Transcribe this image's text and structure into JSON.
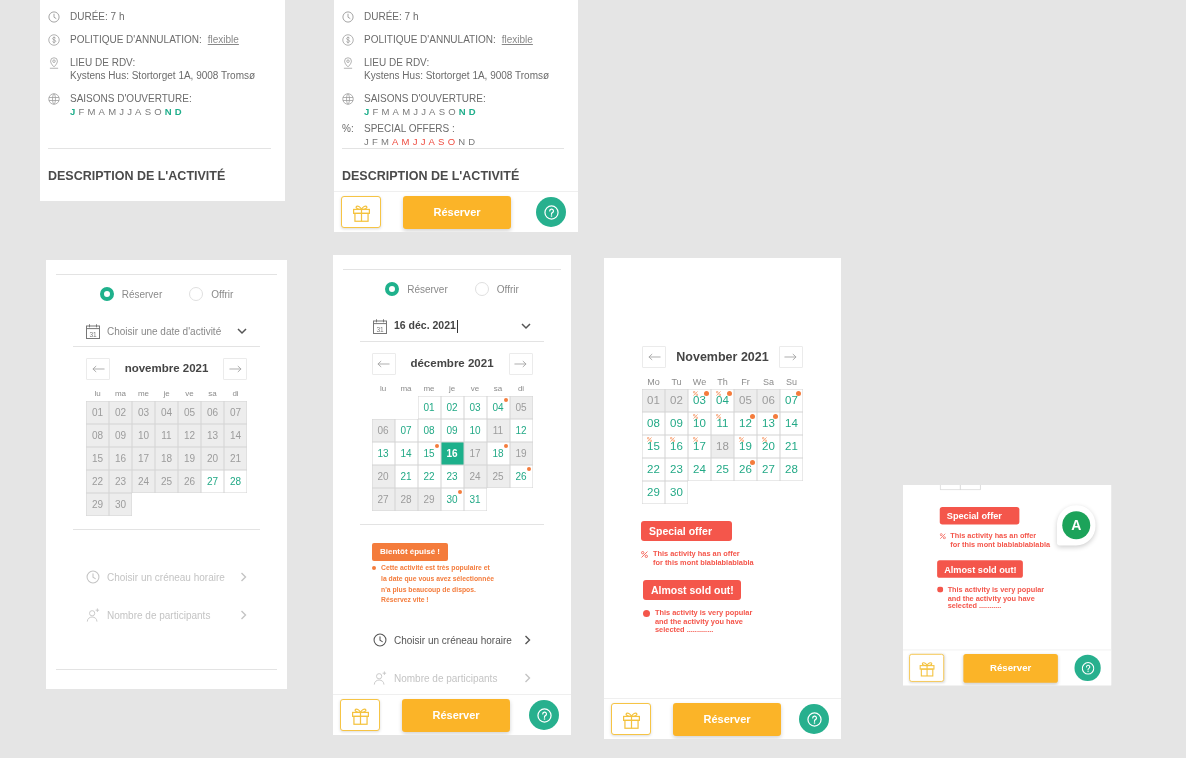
{
  "screens": [
    {
      "blocks": [
        {
          "kind": "info",
          "items": [
            {
              "kind": "duration",
              "label": "DURÉE: 7 h"
            },
            {
              "kind": "cancellation",
              "label": "POLITIQUE D'ANNULATION:",
              "link": "flexible"
            },
            {
              "kind": "meeting_point",
              "label": "LIEU DE RDV:",
              "value": "Kystens Hus: Stortorget 1A, 9008 Tromsø"
            },
            {
              "kind": "seasons",
              "label": "SAISONS D'OUVERTURE:",
              "months": [
                {
                  "letter": "J",
                  "on": true
                },
                {
                  "letter": "F",
                  "on": false
                },
                {
                  "letter": "M",
                  "on": false
                },
                {
                  "letter": "A",
                  "on": false
                },
                {
                  "letter": "M",
                  "on": false
                },
                {
                  "letter": "J",
                  "on": false
                },
                {
                  "letter": "J",
                  "on": false
                },
                {
                  "letter": "A",
                  "on": false
                },
                {
                  "letter": "S",
                  "on": false
                },
                {
                  "letter": "O",
                  "on": false
                },
                {
                  "letter": "N",
                  "on": true
                },
                {
                  "letter": "D",
                  "on": true
                }
              ]
            }
          ]
        },
        {
          "kind": "rule"
        },
        {
          "kind": "heading",
          "text": "DESCRIPTION DE L'ACTIVITÉ"
        }
      ]
    },
    {
      "blocks": [
        {
          "kind": "info",
          "items": [
            {
              "kind": "duration",
              "label": "DURÉE: 7 h"
            },
            {
              "kind": "cancellation",
              "label": "POLITIQUE D'ANNULATION:",
              "link": "flexible"
            },
            {
              "kind": "meeting_point",
              "label": "LIEU DE RDV:",
              "value": "Kystens Hus: Stortorget 1A, 9008 Tromsø"
            },
            {
              "kind": "seasons",
              "label": "SAISONS D'OUVERTURE:",
              "months": [
                {
                  "letter": "J",
                  "on": true
                },
                {
                  "letter": "F",
                  "on": false
                },
                {
                  "letter": "M",
                  "on": false
                },
                {
                  "letter": "A",
                  "on": false
                },
                {
                  "letter": "M",
                  "on": false
                },
                {
                  "letter": "J",
                  "on": false
                },
                {
                  "letter": "J",
                  "on": false
                },
                {
                  "letter": "A",
                  "on": false
                },
                {
                  "letter": "S",
                  "on": false
                },
                {
                  "letter": "O",
                  "on": false
                },
                {
                  "letter": "N",
                  "on": true
                },
                {
                  "letter": "D",
                  "on": true
                }
              ]
            },
            {
              "kind": "offers",
              "prefix": "%:",
              "label": "SPECIAL OFFERS :",
              "months": [
                {
                  "letter": "J",
                  "on": false
                },
                {
                  "letter": "F",
                  "on": false
                },
                {
                  "letter": "M",
                  "on": false
                },
                {
                  "letter": "A",
                  "on": true
                },
                {
                  "letter": "M",
                  "on": true
                },
                {
                  "letter": "J",
                  "on": true
                },
                {
                  "letter": "J",
                  "on": true
                },
                {
                  "letter": "A",
                  "on": true
                },
                {
                  "letter": "S",
                  "on": true
                },
                {
                  "letter": "O",
                  "on": true
                },
                {
                  "letter": "N",
                  "on": false
                },
                {
                  "letter": "D",
                  "on": false
                }
              ]
            }
          ]
        },
        {
          "kind": "rule"
        },
        {
          "kind": "heading",
          "text": "DESCRIPTION DE L'ACTIVITÉ"
        },
        {
          "kind": "footer",
          "book_label": "Réserver"
        }
      ]
    },
    {
      "blocks": [
        {
          "kind": "rule"
        },
        {
          "kind": "choice",
          "options": [
            {
              "label": "Réserver",
              "selected": true
            },
            {
              "label": "Offrir",
              "selected": false
            }
          ]
        },
        {
          "kind": "date_field",
          "icon_label": "31",
          "placeholder": "Choisir une date d'activité",
          "focused": false
        },
        {
          "kind": "calendar",
          "title": "novembre 2021",
          "weekdays": [
            "lu",
            "ma",
            "me",
            "je",
            "ve",
            "sa",
            "di"
          ],
          "days": [
            {
              "kind": "day",
              "day": "01",
              "available": false,
              "selected": false
            },
            {
              "kind": "day",
              "day": "02",
              "available": false,
              "selected": false
            },
            {
              "kind": "day",
              "day": "03",
              "available": false,
              "selected": false
            },
            {
              "kind": "day",
              "day": "04",
              "available": false,
              "selected": false
            },
            {
              "kind": "day",
              "day": "05",
              "available": false,
              "selected": false
            },
            {
              "kind": "day",
              "day": "06",
              "available": false,
              "selected": false
            },
            {
              "kind": "day",
              "day": "07",
              "available": false,
              "selected": false
            },
            {
              "kind": "day",
              "day": "08",
              "available": false,
              "selected": false
            },
            {
              "kind": "day",
              "day": "09",
              "available": false,
              "selected": false
            },
            {
              "kind": "day",
              "day": "10",
              "available": false,
              "selected": false
            },
            {
              "kind": "day",
              "day": "11",
              "available": false,
              "selected": false
            },
            {
              "kind": "day",
              "day": "12",
              "available": false,
              "selected": false
            },
            {
              "kind": "day",
              "day": "13",
              "available": false,
              "selected": false
            },
            {
              "kind": "day",
              "day": "14",
              "available": false,
              "selected": false
            },
            {
              "kind": "day",
              "day": "15",
              "available": false,
              "selected": false
            },
            {
              "kind": "day",
              "day": "16",
              "available": false,
              "selected": false
            },
            {
              "kind": "day",
              "day": "17",
              "available": false,
              "selected": false
            },
            {
              "kind": "day",
              "day": "18",
              "available": false,
              "selected": false
            },
            {
              "kind": "day",
              "day": "19",
              "available": false,
              "selected": false
            },
            {
              "kind": "day",
              "day": "20",
              "available": false,
              "selected": false
            },
            {
              "kind": "day",
              "day": "21",
              "available": false,
              "selected": false
            },
            {
              "kind": "day",
              "day": "22",
              "available": false,
              "selected": false
            },
            {
              "kind": "day",
              "day": "23",
              "available": false,
              "selected": false
            },
            {
              "kind": "day",
              "day": "24",
              "available": false,
              "selected": false
            },
            {
              "kind": "day",
              "day": "25",
              "available": false,
              "selected": false
            },
            {
              "kind": "day",
              "day": "26",
              "available": false,
              "selected": false
            },
            {
              "kind": "day",
              "day": "27",
              "available": true,
              "selected": false
            },
            {
              "kind": "day",
              "day": "28",
              "available": true,
              "selected": false
            },
            {
              "kind": "day",
              "day": "29",
              "available": false,
              "selected": false
            },
            {
              "kind": "day",
              "day": "30",
              "available": false,
              "selected": false
            }
          ]
        },
        {
          "kind": "rule"
        },
        {
          "kind": "steps",
          "items": [
            {
              "kind": "time",
              "label": "Choisir un créneau horaire",
              "disabled": true
            },
            {
              "kind": "participants",
              "label": "Nombre de participants",
              "disabled": true
            }
          ]
        },
        {
          "kind": "rule"
        }
      ]
    },
    {
      "blocks": [
        {
          "kind": "rule"
        },
        {
          "kind": "choice",
          "options": [
            {
              "label": "Réserver",
              "selected": true
            },
            {
              "label": "Offrir",
              "selected": false
            }
          ]
        },
        {
          "kind": "date_field",
          "icon_label": "31",
          "value": "16 déc. 2021",
          "focused": true
        },
        {
          "kind": "calendar",
          "title": "décembre 2021",
          "weekdays": [
            "lu",
            "ma",
            "me",
            "je",
            "ve",
            "sa",
            "di"
          ],
          "days": [
            {
              "kind": "blank"
            },
            {
              "kind": "blank"
            },
            {
              "kind": "day",
              "day": "01",
              "available": true,
              "selected": false,
              "few_left": false
            },
            {
              "kind": "day",
              "day": "02",
              "available": true,
              "selected": false,
              "few_left": false
            },
            {
              "kind": "day",
              "day": "03",
              "available": true,
              "selected": false,
              "few_left": false
            },
            {
              "kind": "day",
              "day": "04",
              "available": true,
              "selected": false,
              "few_left": true
            },
            {
              "kind": "day",
              "day": "05",
              "available": false,
              "selected": false,
              "few_left": false
            },
            {
              "kind": "day",
              "day": "06",
              "available": false,
              "selected": false,
              "few_left": false
            },
            {
              "kind": "day",
              "day": "07",
              "available": true,
              "selected": false,
              "few_left": false
            },
            {
              "kind": "day",
              "day": "08",
              "available": true,
              "selected": false,
              "few_left": false
            },
            {
              "kind": "day",
              "day": "09",
              "available": true,
              "selected": false,
              "few_left": false
            },
            {
              "kind": "day",
              "day": "10",
              "available": true,
              "selected": false,
              "few_left": false
            },
            {
              "kind": "day",
              "day": "11",
              "available": false,
              "selected": false,
              "few_left": false
            },
            {
              "kind": "day",
              "day": "12",
              "available": true,
              "selected": false,
              "few_left": false
            },
            {
              "kind": "day",
              "day": "13",
              "available": true,
              "selected": false,
              "few_left": false
            },
            {
              "kind": "day",
              "day": "14",
              "available": true,
              "selected": false,
              "few_left": false
            },
            {
              "kind": "day",
              "day": "15",
              "available": true,
              "selected": false,
              "few_left": true
            },
            {
              "kind": "day",
              "day": "16",
              "available": true,
              "selected": true,
              "few_left": false
            },
            {
              "kind": "day",
              "day": "17",
              "available": false,
              "selected": false,
              "few_left": false
            },
            {
              "kind": "day",
              "day": "18",
              "available": true,
              "selected": false,
              "few_left": true
            },
            {
              "kind": "day",
              "day": "19",
              "available": false,
              "selected": false,
              "few_left": false
            },
            {
              "kind": "day",
              "day": "20",
              "available": false,
              "selected": false,
              "few_left": false
            },
            {
              "kind": "day",
              "day": "21",
              "available": true,
              "selected": false,
              "few_left": false
            },
            {
              "kind": "day",
              "day": "22",
              "available": true,
              "selected": false,
              "few_left": false
            },
            {
              "kind": "day",
              "day": "23",
              "available": true,
              "selected": false,
              "few_left": false
            },
            {
              "kind": "day",
              "day": "24",
              "available": false,
              "selected": false,
              "few_left": false
            },
            {
              "kind": "day",
              "day": "25",
              "available": false,
              "selected": false,
              "few_left": false
            },
            {
              "kind": "day",
              "day": "26",
              "available": true,
              "selected": false,
              "few_left": true
            },
            {
              "kind": "day",
              "day": "27",
              "available": false,
              "selected": false,
              "few_left": false
            },
            {
              "kind": "day",
              "day": "28",
              "available": false,
              "selected": false,
              "few_left": false
            },
            {
              "kind": "day",
              "day": "29",
              "available": false,
              "selected": false,
              "few_left": false
            },
            {
              "kind": "day",
              "day": "30",
              "available": true,
              "selected": false,
              "few_left": true
            },
            {
              "kind": "day",
              "day": "31",
              "available": true,
              "selected": false,
              "few_left": false
            }
          ]
        },
        {
          "kind": "rule"
        },
        {
          "kind": "sold_out_notice",
          "color": "#f47c3c",
          "badge": "Bientôt épuisé !",
          "text": "Cette activité est très populaire et\nla date que vous avez sélectionnée\nn'a plus beaucoup de dispos.\nRéservez vite !"
        },
        {
          "kind": "steps",
          "items": [
            {
              "kind": "time",
              "label": "Choisir un créneau horaire",
              "disabled": false
            },
            {
              "kind": "participants",
              "label": "Nombre de participants",
              "disabled": true
            }
          ]
        },
        {
          "kind": "footer",
          "book_label": "Réserver"
        }
      ]
    },
    {
      "blocks": [
        {
          "kind": "calendar",
          "title": "November 2021",
          "weekdays": [
            "Mo",
            "Tu",
            "We",
            "Th",
            "Fr",
            "Sa",
            "Su"
          ],
          "days": [
            {
              "kind": "day",
              "day": "01",
              "available": false,
              "selected": false,
              "offer": false,
              "few_left": false
            },
            {
              "kind": "day",
              "day": "02",
              "available": false,
              "selected": false,
              "offer": false,
              "few_left": false
            },
            {
              "kind": "day",
              "day": "03",
              "available": true,
              "selected": false,
              "offer": true,
              "few_left": true
            },
            {
              "kind": "day",
              "day": "04",
              "available": true,
              "selected": false,
              "offer": true,
              "few_left": true
            },
            {
              "kind": "day",
              "day": "05",
              "available": false,
              "selected": false,
              "offer": false,
              "few_left": false
            },
            {
              "kind": "day",
              "day": "06",
              "available": false,
              "selected": false,
              "offer": false,
              "few_left": false
            },
            {
              "kind": "day",
              "day": "07",
              "available": true,
              "selected": false,
              "offer": false,
              "few_left": true
            },
            {
              "kind": "day",
              "day": "08",
              "available": true,
              "selected": false,
              "offer": false,
              "few_left": false
            },
            {
              "kind": "day",
              "day": "09",
              "available": true,
              "selected": false,
              "offer": false,
              "few_left": false
            },
            {
              "kind": "day",
              "day": "10",
              "available": true,
              "selected": false,
              "offer": true,
              "few_left": false
            },
            {
              "kind": "day",
              "day": "11",
              "available": true,
              "selected": false,
              "offer": true,
              "few_left": false
            },
            {
              "kind": "day",
              "day": "12",
              "available": true,
              "selected": false,
              "offer": false,
              "few_left": true
            },
            {
              "kind": "day",
              "day": "13",
              "available": true,
              "selected": false,
              "offer": false,
              "few_left": true
            },
            {
              "kind": "day",
              "day": "14",
              "available": true,
              "selected": false,
              "offer": false,
              "few_left": false
            },
            {
              "kind": "day",
              "day": "15",
              "available": true,
              "selected": false,
              "offer": true,
              "few_left": false
            },
            {
              "kind": "day",
              "day": "16",
              "available": true,
              "selected": false,
              "offer": true,
              "few_left": false
            },
            {
              "kind": "day",
              "day": "17",
              "available": true,
              "selected": false,
              "offer": true,
              "few_left": false
            },
            {
              "kind": "day",
              "day": "18",
              "available": false,
              "selected": false,
              "offer": false,
              "few_left": false
            },
            {
              "kind": "day",
              "day": "19",
              "available": true,
              "selected": false,
              "offer": true,
              "few_left": false
            },
            {
              "kind": "day",
              "day": "20",
              "available": true,
              "selected": false,
              "offer": true,
              "few_left": false
            },
            {
              "kind": "day",
              "day": "21",
              "available": true,
              "selected": false,
              "offer": false,
              "few_left": false
            },
            {
              "kind": "day",
              "day": "22",
              "available": true,
              "selected": false,
              "offer": false,
              "few_left": false
            },
            {
              "kind": "day",
              "day": "23",
              "available": true,
              "selected": false,
              "offer": false,
              "few_left": false
            },
            {
              "kind": "day",
              "day": "24",
              "available": true,
              "selected": false,
              "offer": false,
              "few_left": false
            },
            {
              "kind": "day",
              "day": "25",
              "available": true,
              "selected": false,
              "offer": false,
              "few_left": false
            },
            {
              "kind": "day",
              "day": "26",
              "available": true,
              "selected": false,
              "offer": false,
              "few_left": true
            },
            {
              "kind": "day",
              "day": "27",
              "available": true,
              "selected": false,
              "offer": false,
              "few_left": false
            },
            {
              "kind": "day",
              "day": "28",
              "available": true,
              "selected": false,
              "offer": false,
              "few_left": false
            },
            {
              "kind": "day",
              "day": "29",
              "available": true,
              "selected": false,
              "offer": false,
              "few_left": false
            },
            {
              "kind": "day",
              "day": "30",
              "available": true,
              "selected": false,
              "offer": false,
              "few_left": false
            }
          ]
        },
        {
          "kind": "offer_notice",
          "color": "#f4564b",
          "badge": "Special offer",
          "text": "This activity has an offer\nfor this mont blablablablabla"
        },
        {
          "kind": "sold_out_notice",
          "color": "#f4564b",
          "badge": "Almost sold out!",
          "text": "This activity is very popular\nand the activity you have\nselected ............."
        },
        {
          "kind": "footer",
          "book_label": "Réserver"
        }
      ]
    },
    {
      "blocks": [
        {
          "kind": "calendar_edge"
        },
        {
          "kind": "offer_notice",
          "color": "#f4564b",
          "badge": "Special offer",
          "text": "This activity has an offer\nfor this mont blablablablabla"
        },
        {
          "kind": "sold_out_notice",
          "color": "#f4564b",
          "badge": "Almost sold out!",
          "text": "This activity is very popular\nand the activity you have\nselected ..........."
        },
        {
          "kind": "footer",
          "book_label": "Réserver"
        },
        {
          "kind": "avatar",
          "initial": "A"
        }
      ]
    }
  ]
}
